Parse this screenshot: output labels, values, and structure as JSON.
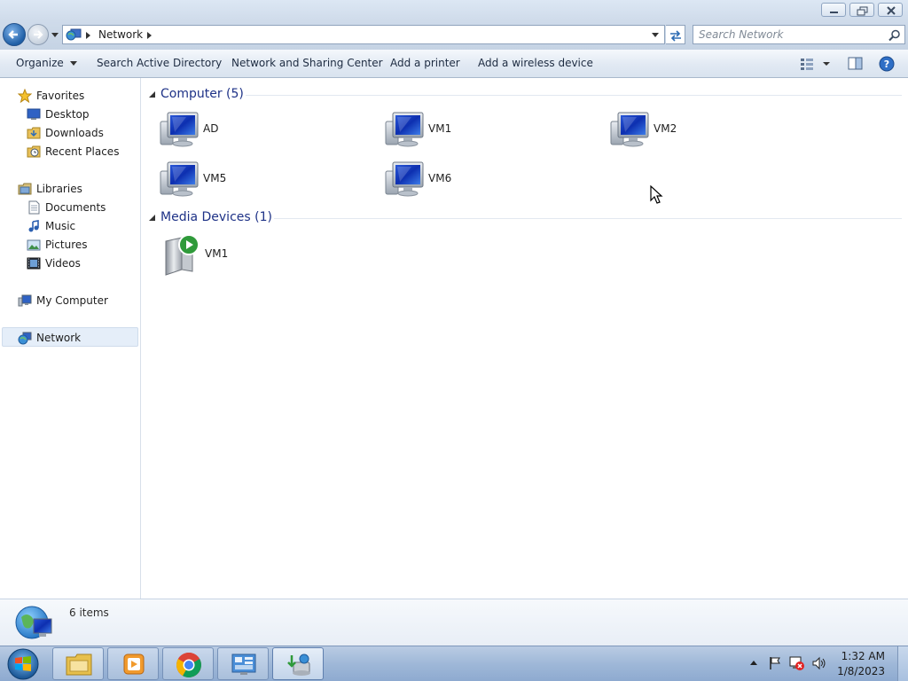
{
  "window": {
    "address_path": "Network",
    "search_placeholder": "Search Network"
  },
  "toolbar": {
    "organize": "Organize",
    "search_ad": "Search Active Directory",
    "network_sharing": "Network and Sharing Center",
    "add_printer": "Add a printer",
    "add_wireless": "Add a wireless device"
  },
  "sidebar": {
    "favorites": "Favorites",
    "desktop": "Desktop",
    "downloads": "Downloads",
    "recent_places": "Recent Places",
    "libraries": "Libraries",
    "documents": "Documents",
    "music": "Music",
    "pictures": "Pictures",
    "videos": "Videos",
    "my_computer": "My Computer",
    "network": "Network"
  },
  "groups": {
    "computer": {
      "header": "Computer (5)",
      "items": [
        "AD",
        "VM1",
        "VM2",
        "VM5",
        "VM6"
      ]
    },
    "media": {
      "header": "Media Devices (1)",
      "items": [
        "VM1"
      ]
    }
  },
  "status": {
    "item_count": "6 items"
  },
  "taskbar": {
    "time": "1:32 AM",
    "date": "1/8/2023"
  },
  "icons": {
    "computer": "computer-monitor-icon",
    "media": "media-device-icon",
    "network": "network-globe-icon"
  },
  "colors": {
    "accent": "#1e3287",
    "selection": "#e5eef9"
  }
}
